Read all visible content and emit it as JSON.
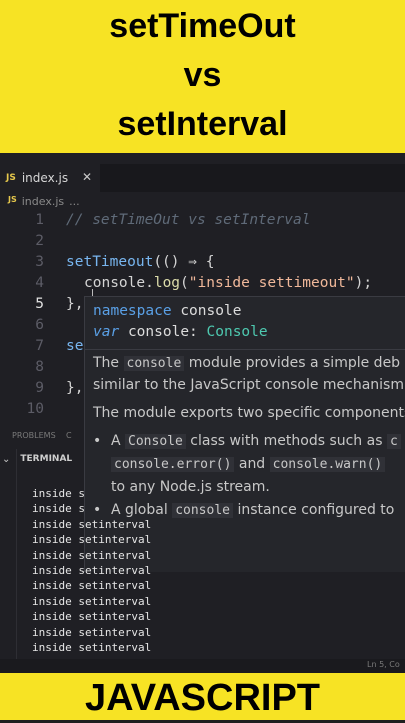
{
  "banner": {
    "line1": "setTimeOut",
    "line2": "vs",
    "line3": "setInterval",
    "footer": "JAVASCRIPT",
    "color": "#f7e324"
  },
  "editor": {
    "tab": {
      "badge": "JS",
      "label": "index.js",
      "close": "✕"
    },
    "breadcrumb": {
      "badge": "JS",
      "file": "index.js",
      "more": "..."
    },
    "line_numbers": [
      "1",
      "2",
      "3",
      "4",
      "5",
      "6",
      "7",
      "8",
      "9",
      "10"
    ],
    "code": {
      "l1": "// setTimeOut vs setInterval",
      "l3a": "setTimeout",
      "l3b": "(() ⇒ {",
      "l4a": "console",
      "l4b": ".",
      "l4c": "log",
      "l4d": "(",
      "l4e": "\"inside settimeout\"",
      "l4f": ");",
      "l5": "},",
      "l7": "se",
      "l9": "},"
    },
    "hover": {
      "sig1_kw": "namespace",
      "sig1_name": "console",
      "sig2_kw": "var",
      "sig2_name": "console",
      "sig2_colon": ":",
      "sig2_type": "Console",
      "p1a": "The",
      "p1code": "console",
      "p1b": "module provides a simple deb",
      "p2": "similar to the JavaScript console mechanism p",
      "p3": "The module exports two specific components",
      "b1a": "A",
      "b1code": "Console",
      "b1b": "class with methods such as",
      "b1tail": "c",
      "b2code1": "console.error()",
      "b2and": "and",
      "b2code2": "console.warn()",
      "b3": "to any Node.js stream.",
      "b4a": "A global",
      "b4code": "console",
      "b4b": "instance configured to"
    }
  },
  "panel": {
    "problems": "PROBLEMS",
    "other": "C",
    "terminal": "TERMINAL",
    "lines": [
      "inside s",
      "inside s",
      "inside setinterval",
      "inside setinterval",
      "inside setinterval",
      "inside setinterval",
      "inside setinterval",
      "inside setinterval",
      "inside setinterval",
      "inside setinterval",
      "inside setinterval"
    ]
  },
  "status": {
    "position": "Ln 5, Co"
  }
}
